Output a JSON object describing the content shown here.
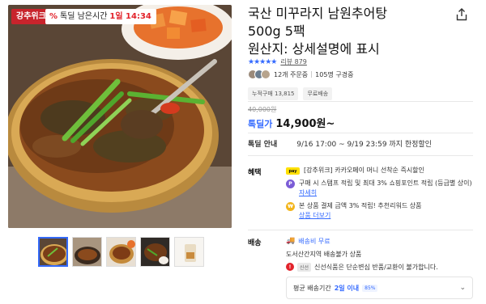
{
  "product": {
    "title_line1": "국산 미꾸라지 남원추어탕",
    "title_line2": "500g 5팩",
    "title_line3": "원산지: 상세설명에 표시"
  },
  "image_badges": {
    "store": "강추위크",
    "timer_prefix": "%",
    "timer_label": "톡딜 남은시간",
    "timer_value": "1일 14:34"
  },
  "rating": {
    "stars": "★★★★★",
    "reviews": "리뷰 879"
  },
  "buyers": {
    "orders": "12개 주문중",
    "reorders": "105명 구경중"
  },
  "chips": [
    "누적구매 13,815",
    "무료배송"
  ],
  "price": {
    "original": "40,000원",
    "label": "톡딜가",
    "value": "14,900원~"
  },
  "deal": {
    "label": "톡딜 안내",
    "period": "9/16 17:00 ~ 9/19 23:59 까지 한정할인"
  },
  "benefits": {
    "label": "혜택",
    "items": [
      {
        "icon": "pay",
        "icon_text": "pay",
        "text": "[강추위크] 카카오페이 머니 선착순 즉시할인",
        "link": ""
      },
      {
        "icon": "p",
        "icon_text": "P",
        "text": "구매 시 스탬프 적립 및 최대 3% 쇼핑포인트 적립 (등급별 상이)",
        "link": "자세히"
      },
      {
        "icon": "coin",
        "icon_text": "₩",
        "text": "본 상품 결제 금액 3% 적립! 추천리워드 상품",
        "link": "상품 더보기"
      }
    ]
  },
  "shipping": {
    "label": "배송",
    "line1": "배송비 무료",
    "line2": "도서산간지역 배송불가 상품",
    "line3": "신선식품은 단순변심 반품/교환이 불가합니다."
  },
  "delivery": {
    "prefix": "평균 배송기간",
    "days": "2일 이내",
    "badge": "85%"
  },
  "colors": {
    "accent": "#346aff",
    "red": "#e2232b",
    "store_red": "#c8242c"
  }
}
